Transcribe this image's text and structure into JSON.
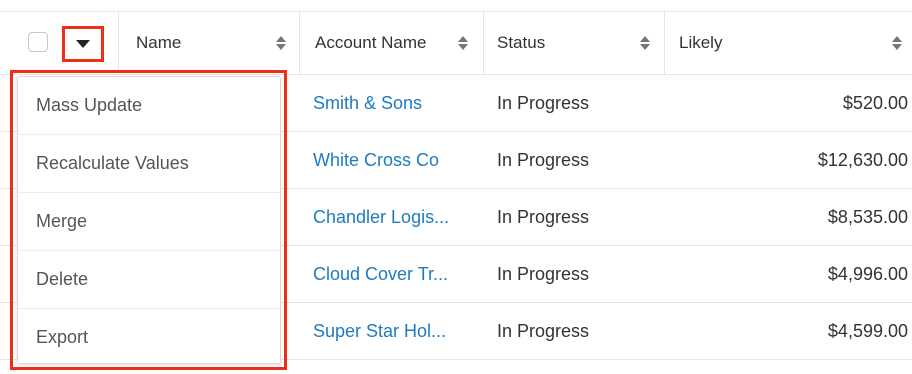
{
  "table": {
    "columns": [
      {
        "label": "Name"
      },
      {
        "label": "Account Name"
      },
      {
        "label": "Status"
      },
      {
        "label": "Likely"
      }
    ],
    "rows": [
      {
        "account_name": "Smith & Sons",
        "status": "In Progress",
        "likely": "$520.00"
      },
      {
        "account_name": "White Cross Co",
        "status": "In Progress",
        "likely": "$12,630.00"
      },
      {
        "account_name": "Chandler Logis...",
        "status": "In Progress",
        "likely": "$8,535.00"
      },
      {
        "account_name": "Cloud Cover Tr...",
        "status": "In Progress",
        "likely": "$4,996.00"
      },
      {
        "account_name": "Super Star Hol...",
        "status": "In Progress",
        "likely": "$4,599.00"
      }
    ]
  },
  "mass_actions_menu": {
    "items": [
      {
        "label": "Mass Update"
      },
      {
        "label": "Recalculate Values"
      },
      {
        "label": "Merge"
      },
      {
        "label": "Delete"
      },
      {
        "label": "Export"
      }
    ]
  },
  "icons": {
    "dropdown": "caret-down-icon",
    "sort": "sort-arrows-icon",
    "checkbox": "select-all-checkbox"
  },
  "colors": {
    "link": "#1f7bc0",
    "highlight": "#ec2f16",
    "border": "#e5e5e5",
    "text": "#333333"
  }
}
